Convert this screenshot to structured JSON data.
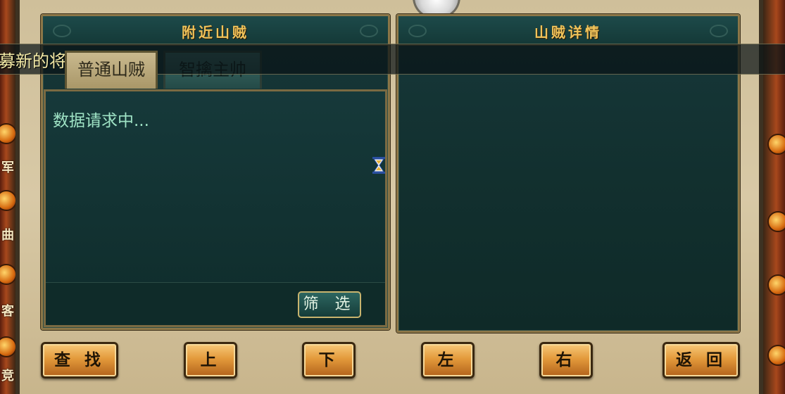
{
  "left_panel": {
    "title": "附近山贼",
    "tabs": [
      {
        "label": "普通山贼",
        "active": true
      },
      {
        "label": "智擒主帅",
        "active": false
      }
    ],
    "status_text": "数据请求中...",
    "filter_button": "筛 选"
  },
  "right_panel": {
    "title": "山贼详情"
  },
  "buttons": {
    "search": "查 找",
    "up": "上",
    "down": "下",
    "left": "左",
    "right": "右",
    "back": "返 回"
  },
  "notice": {
    "text": "募新的将领了。"
  },
  "side_bar": {
    "left_chars": [
      "军",
      "曲",
      "客",
      "竞"
    ]
  },
  "colors": {
    "panel_bg": "#12302f",
    "title_gold": "#f0c35a",
    "button_orange": "#e39a3b",
    "status_green": "#9fe3c5"
  }
}
